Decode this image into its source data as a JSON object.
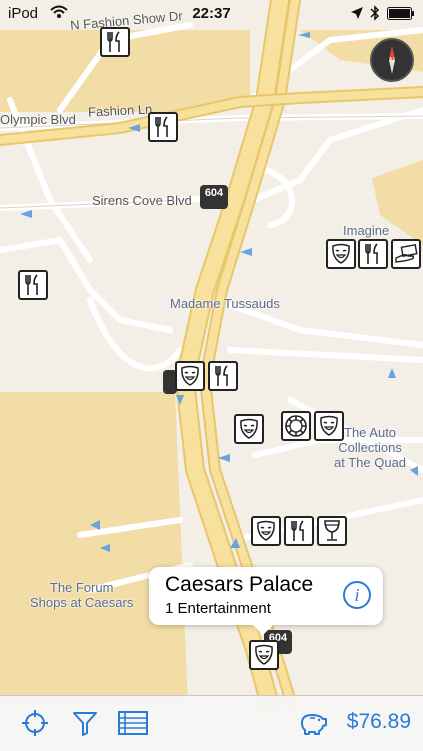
{
  "status_bar": {
    "carrier": "iPod",
    "time": "22:37"
  },
  "streets": {
    "n_fashion_show": "N Fashion Show Dr",
    "olympic": "Olympic Blvd",
    "fashion_ln": "Fashion Ln",
    "sirens_cove": "Sirens Cove Blvd"
  },
  "places": {
    "imagine": "Imagine",
    "madame_tussauds": "Madame Tussauds",
    "auto_collections_1": "The Auto",
    "auto_collections_2": "Collections",
    "auto_collections_3": "at The Quad",
    "forum_1": "The Forum",
    "forum_2": "Shops at Caesars"
  },
  "route_shield": "604",
  "callout": {
    "title": "Caesars Palace",
    "subtitle": "1 Entertainment"
  },
  "toolbar": {
    "balance": "$76.89"
  },
  "icons": {
    "locate": "crosshair-icon",
    "filter": "filter-icon",
    "list": "list-icon",
    "budget": "piggy-bank-icon",
    "compass": "compass-icon"
  },
  "colors": {
    "accent": "#2a7bd8",
    "road": "#f5d98a",
    "sand": "#f2dda6",
    "land": "#f3efe6"
  }
}
